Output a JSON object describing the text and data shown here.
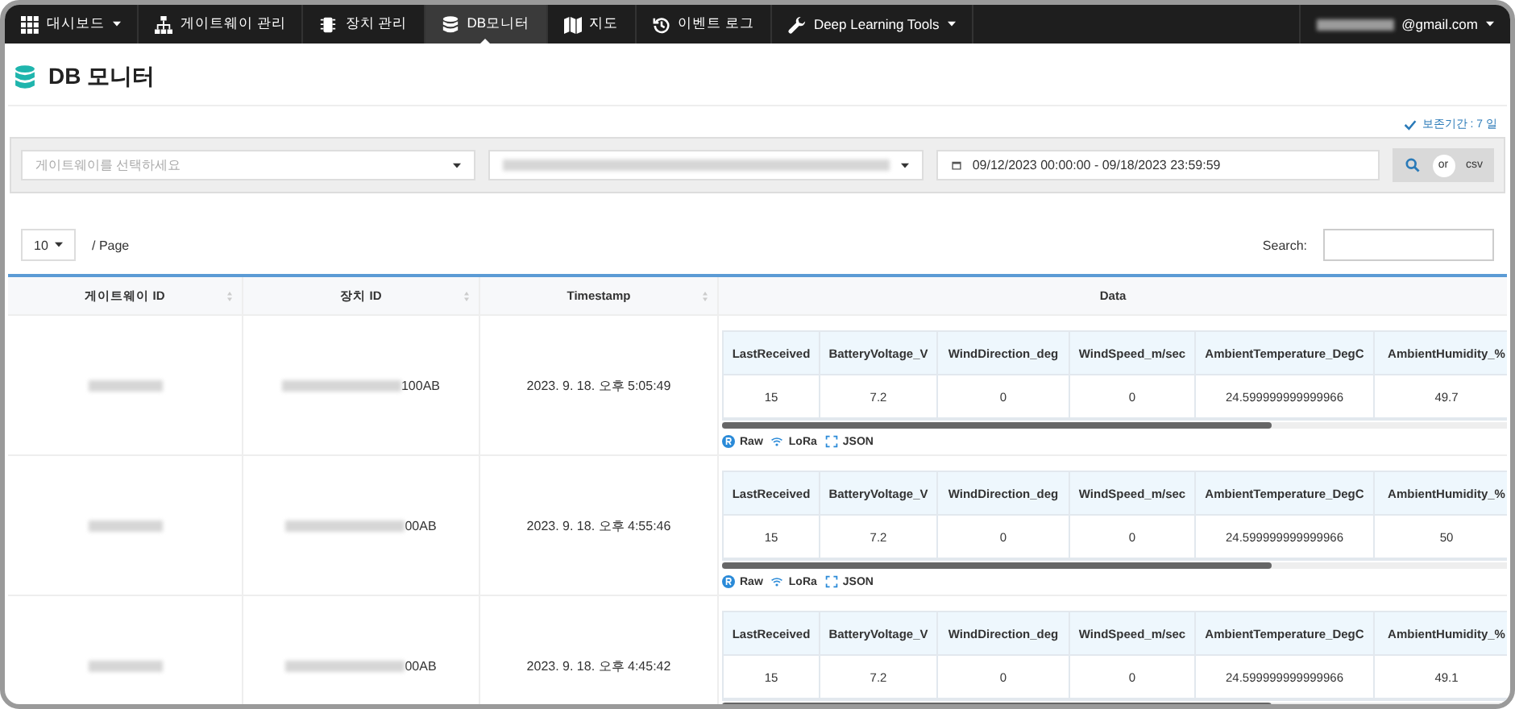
{
  "nav": {
    "items": [
      {
        "label": "대시보드",
        "dropdown": true,
        "selected": false
      },
      {
        "label": "게이트웨이 관리",
        "dropdown": false,
        "selected": false
      },
      {
        "label": "장치 관리",
        "dropdown": false,
        "selected": false
      },
      {
        "label": "DB모니터",
        "dropdown": false,
        "selected": true
      },
      {
        "label": "지도",
        "dropdown": false,
        "selected": false
      },
      {
        "label": "이벤트 로그",
        "dropdown": false,
        "selected": false
      },
      {
        "label": "Deep Learning Tools",
        "dropdown": true,
        "selected": false
      }
    ],
    "user": {
      "email": "@gmail.com"
    }
  },
  "title": "DB 모니터",
  "retention": "보존기간 : 7 일",
  "filters": {
    "gateway": {
      "placeholder": "게이트웨이를 선택하세요"
    },
    "date_range": "09/12/2023 00:00:00 - 09/18/2023 23:59:59",
    "or": "or",
    "csv": "csv"
  },
  "page_size": "10",
  "per_page": "/ Page",
  "search_label": "Search:",
  "table": {
    "columns": [
      "게이트웨이 ID",
      "장치 ID",
      "Timestamp",
      "Data"
    ],
    "rows": [
      {
        "device_id": "100AB",
        "timestamp": "2023. 9. 18. 오후 5:05:49",
        "data": {
          "columns": [
            "LastReceived",
            "BatteryVoltage_V",
            "WindDirection_deg",
            "WindSpeed_m/sec",
            "AmbientTemperature_DegC",
            "AmbientHumidity_%"
          ],
          "values": [
            "15",
            "7.2",
            "0",
            "0",
            "24.599999999999966",
            "49.7"
          ]
        },
        "links": [
          "Raw",
          "LoRa",
          "JSON"
        ]
      },
      {
        "device_id": "00AB",
        "timestamp": "2023. 9. 18. 오후 4:55:46",
        "data": {
          "columns": [
            "LastReceived",
            "BatteryVoltage_V",
            "WindDirection_deg",
            "WindSpeed_m/sec",
            "AmbientTemperature_DegC",
            "AmbientHumidity_%"
          ],
          "values": [
            "15",
            "7.2",
            "0",
            "0",
            "24.599999999999966",
            "50"
          ]
        },
        "links": [
          "Raw",
          "LoRa",
          "JSON"
        ]
      },
      {
        "device_id": "00AB",
        "timestamp": "2023. 9. 18. 오후 4:45:42",
        "data": {
          "columns": [
            "LastReceived",
            "BatteryVoltage_V",
            "WindDirection_deg",
            "WindSpeed_m/sec",
            "AmbientTemperature_DegC",
            "AmbientHumidity_%"
          ],
          "values": [
            "15",
            "7.2",
            "0",
            "0",
            "24.599999999999966",
            "49.1"
          ]
        },
        "links": []
      }
    ]
  }
}
